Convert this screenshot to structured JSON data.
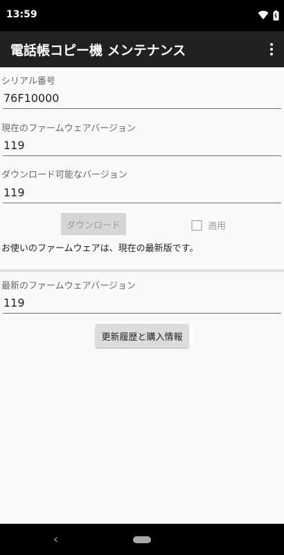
{
  "status_bar": {
    "time": "13:59"
  },
  "app_bar": {
    "title": "電話帳コピー機 メンテナンス"
  },
  "serial": {
    "label": "シリアル番号",
    "value": "76F10000"
  },
  "current_fw": {
    "label": "現在のファームウェアバージョン",
    "value": "119"
  },
  "downloadable": {
    "label": "ダウンロード可能なバージョン",
    "value": "119"
  },
  "download_button": {
    "label": "ダウンロード"
  },
  "apply_checkbox": {
    "label": "適用",
    "checked": false
  },
  "message": "お使いのファームウェアは、現在の最新版です。",
  "latest_fw": {
    "label": "最新のファームウェアバージョン",
    "value": "119"
  },
  "history_button": {
    "label": "更新履歴と購入情報"
  },
  "colors": {
    "app_bar": "#212121",
    "background": "#fafafa",
    "button": "#dcdcdc",
    "disabled_text": "#9a9a9a"
  }
}
